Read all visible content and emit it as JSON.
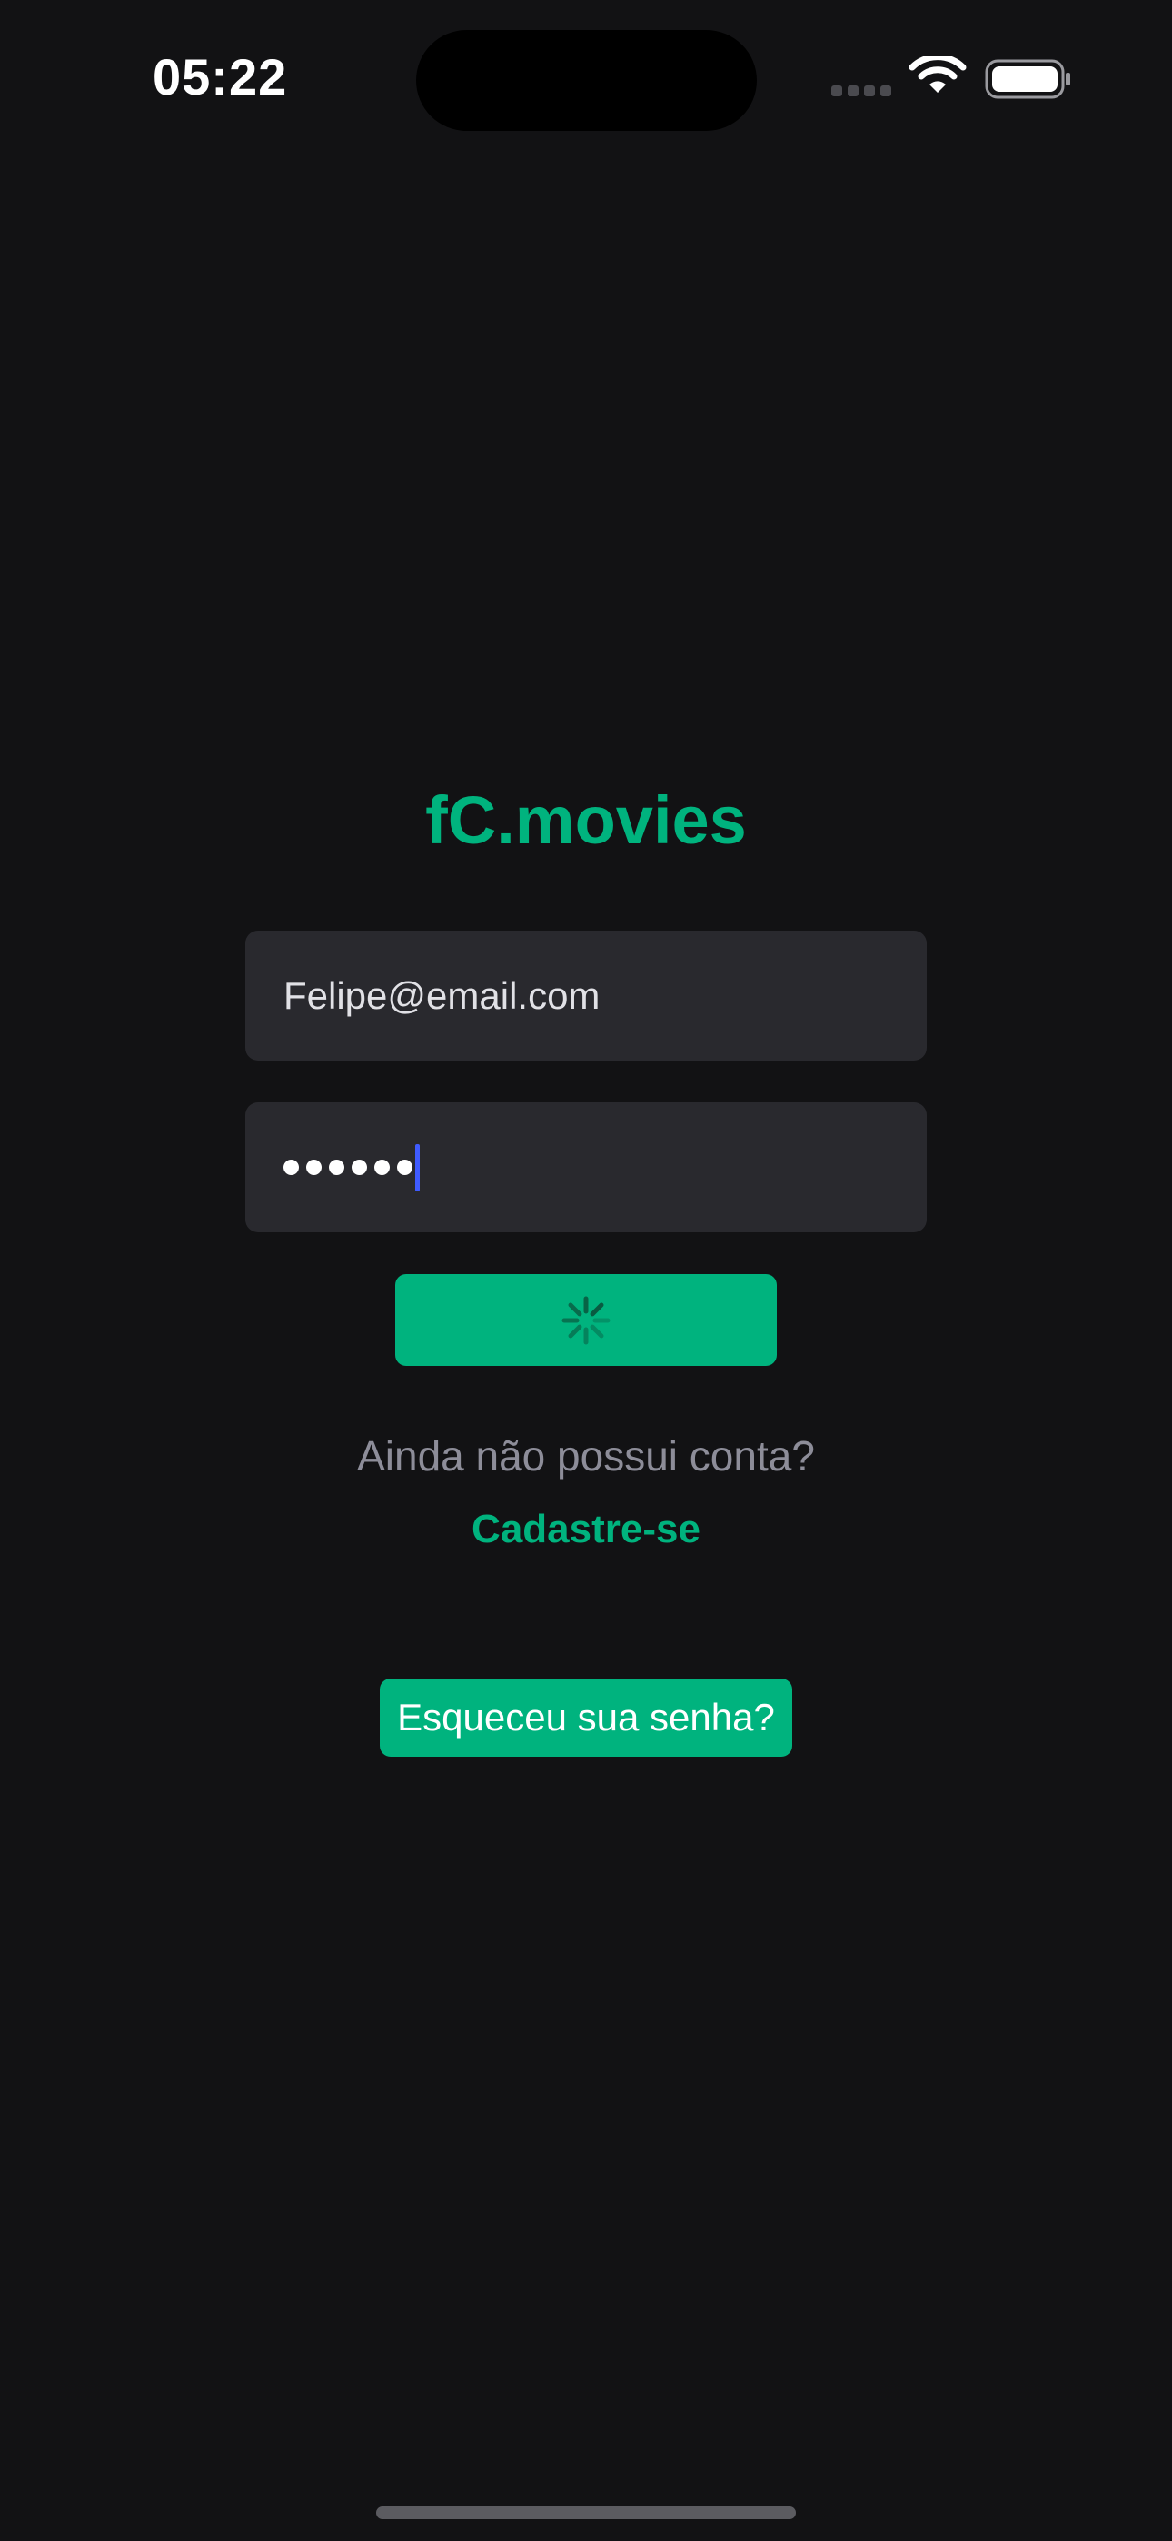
{
  "status_bar": {
    "time": "05:22"
  },
  "app": {
    "title": "fC.movies"
  },
  "login": {
    "email_value": "Felipe@email.com",
    "password_length": 6
  },
  "signup": {
    "prompt": "Ainda não possui conta?",
    "link_label": "Cadastre-se"
  },
  "forgot": {
    "label": "Esqueceu sua senha?"
  },
  "colors": {
    "background": "#121214",
    "accent": "#00b37e",
    "field_background": "#29292e",
    "muted_text": "#8d8d99",
    "caret": "#3f5bff"
  },
  "icons": [
    "cellular-signal-icon",
    "wifi-icon",
    "battery-icon",
    "loading-spinner-icon"
  ]
}
